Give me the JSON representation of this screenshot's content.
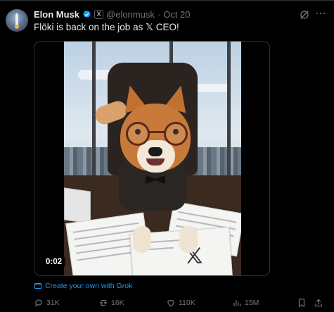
{
  "post": {
    "author_name": "Elon Musk",
    "handle": "@elonmusk",
    "separator": "·",
    "date": "Oct 20",
    "affiliate_badge": "X",
    "text": "Flōki is back on the job as 𝕏 CEO!",
    "video_duration": "0:02",
    "grok_link": "Create your own with Grok"
  },
  "actions": {
    "replies": "31K",
    "reposts": "16K",
    "likes": "110K",
    "views": "15M"
  },
  "icons": {
    "verified": "verified-badge-icon",
    "grok": "grok-icon",
    "more": "more-icon",
    "reply": "reply-icon",
    "repost": "repost-icon",
    "like": "heart-icon",
    "views": "views-icon",
    "bookmark": "bookmark-icon",
    "share": "share-icon"
  },
  "colors": {
    "background": "#000000",
    "text": "#e7e9ea",
    "muted": "#71767b",
    "accent": "#1d9bf0"
  }
}
